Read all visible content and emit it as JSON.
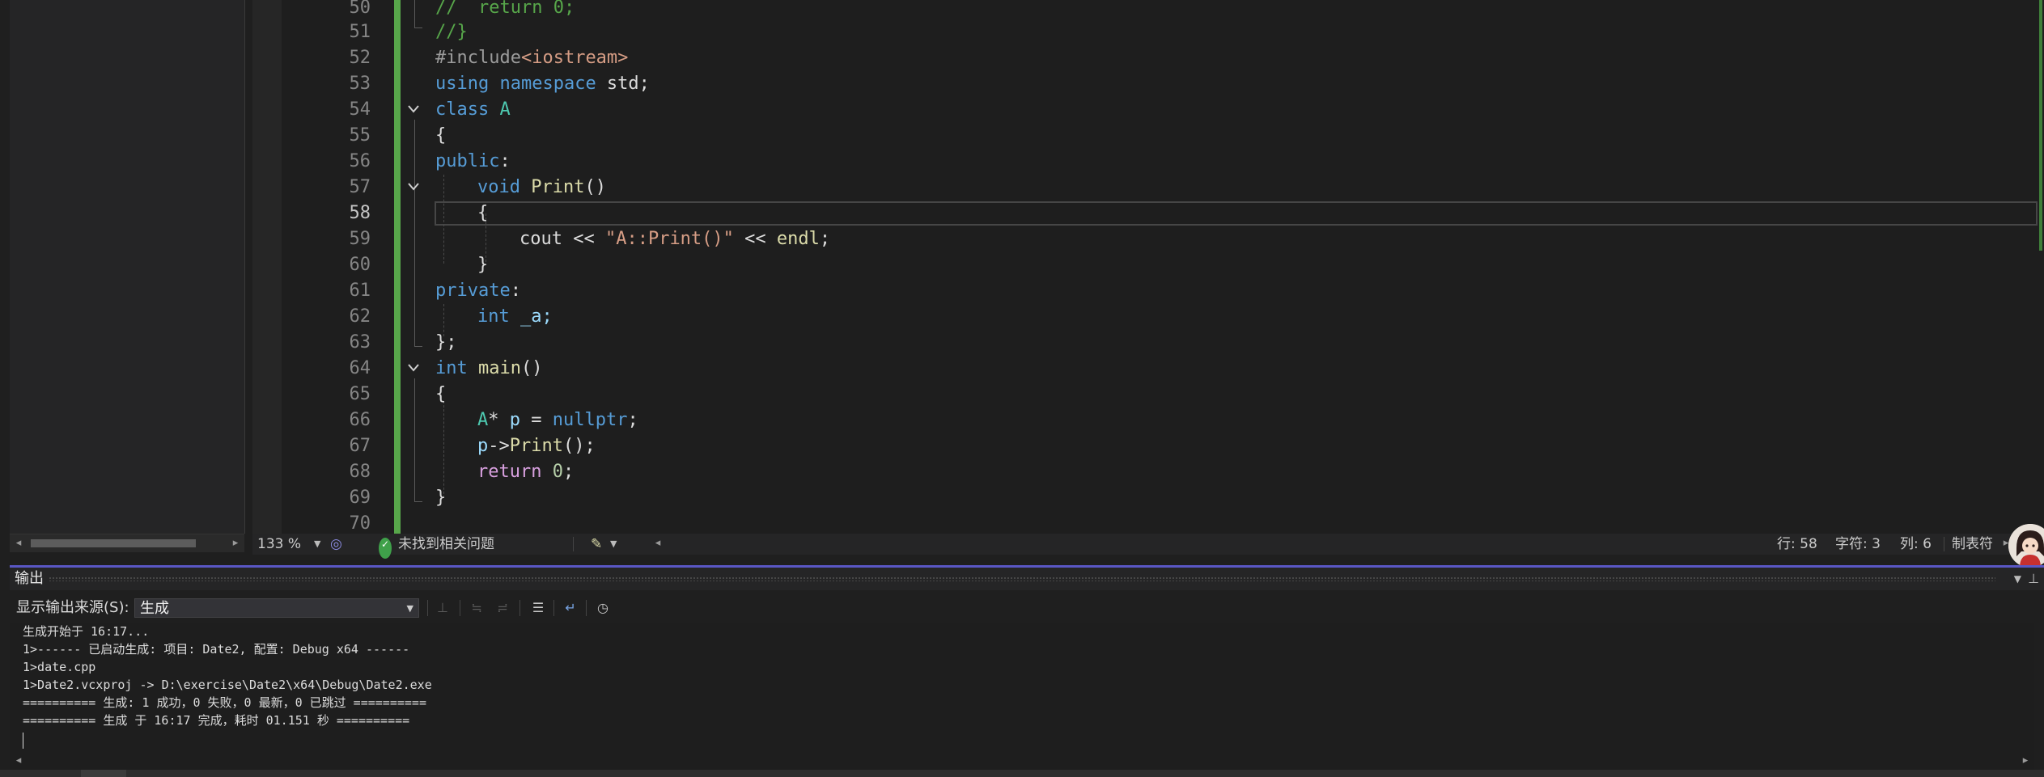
{
  "editor": {
    "line_numbers": [
      "50",
      "51",
      "52",
      "53",
      "54",
      "55",
      "56",
      "57",
      "58",
      "59",
      "60",
      "61",
      "62",
      "63",
      "64",
      "65",
      "66",
      "67",
      "68",
      "69",
      "70"
    ],
    "current_line": "58",
    "code": {
      "l50": "//  return 0;",
      "l51": "//}",
      "l52_a": "#include",
      "l52_b": "<iostream>",
      "l53_a": "using",
      "l53_b": " namespace",
      "l53_c": " std;",
      "l54_a": "class",
      "l54_b": " A",
      "l55": "{",
      "l56_a": "public",
      "l56_b": ":",
      "l57_a": "void",
      "l57_b": " Print",
      "l57_c": "()",
      "l58": "{",
      "l59_a": "cout",
      "l59_b": " << ",
      "l59_c": "\"A::Print()\"",
      "l59_d": " << ",
      "l59_e": "endl",
      "l59_f": ";",
      "l60": "}",
      "l61_a": "private",
      "l61_b": ":",
      "l62_a": "int",
      "l62_b": " _a;",
      "l63": "};",
      "l64_a": "int",
      "l64_b": " main",
      "l64_c": "()",
      "l65": "{",
      "l66_a": "A",
      "l66_b": "* ",
      "l66_c": "p",
      "l66_d": " = ",
      "l66_e": "nullptr",
      "l66_f": ";",
      "l67_a": "p",
      "l67_b": "->",
      "l67_c": "Print",
      "l67_d": "();",
      "l68_a": "return",
      "l68_b": " 0",
      "l68_c": ";",
      "l69": "}"
    }
  },
  "editor_status": {
    "zoom": "133 %",
    "issues": "未找到相关问题",
    "row": "行: 58",
    "char": "字符: 3",
    "col": "列: 6",
    "tabs": "制表符"
  },
  "output_panel": {
    "title": "输出",
    "source_label": "显示输出来源(S):",
    "source_value": "生成",
    "lines": [
      "生成开始于 16:17...",
      "1>------ 已启动生成: 项目: Date2, 配置: Debug x64 ------",
      "1>date.cpp",
      "1>Date2.vcxproj -> D:\\exercise\\Date2\\x64\\Debug\\Date2.exe",
      "========== 生成: 1 成功，0 失败，0 最新，0 已跳过 ==========",
      "========== 生成 于 16:17 完成，耗时 01.151 秒 =========="
    ]
  },
  "icons": {
    "fold": "chevron-down-icon",
    "issues": "check-circle-icon",
    "cleanup": "brush-icon",
    "clear": "clear-all-icon",
    "wrap": "word-wrap-icon",
    "timestamp": "clock-icon"
  },
  "colors": {
    "accent": "#5a57c4",
    "change_bar": "#57a64a",
    "keyword": "#569cd6",
    "type": "#4ec9b0",
    "string": "#d69d85",
    "comment": "#57a64a"
  }
}
